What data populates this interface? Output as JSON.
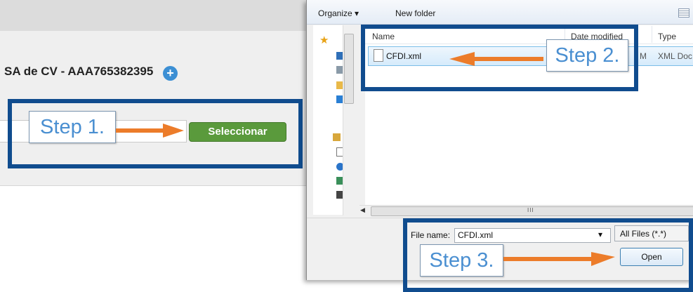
{
  "page": {
    "company_name": "SA de CV - AAA765382395",
    "plus_glyph": "+",
    "select_button": "Seleccionar"
  },
  "dialog": {
    "toolbar": {
      "organize": "Organize ▾",
      "new_folder": "New folder"
    },
    "columns": [
      "Name",
      "Date modified",
      "Type"
    ],
    "files": [
      {
        "name": "CFDI.xml",
        "date_fragment": "M",
        "type": "XML Doc"
      }
    ],
    "scroll_marker": "III",
    "file_name_label": "File name:",
    "file_name_value": "CFDI.xml",
    "file_name_dropdown": "▾",
    "filter": "All Files (*.*)",
    "open_button": "Open"
  },
  "annotations": {
    "step1": "Step 1.",
    "step2": "Step 2.",
    "step3": "Step 3."
  },
  "colors": {
    "callout_border": "#104c8e",
    "arrow": "#ec7c2a",
    "step_text": "#4a8fd1",
    "select_button": "#5a9a3c"
  }
}
